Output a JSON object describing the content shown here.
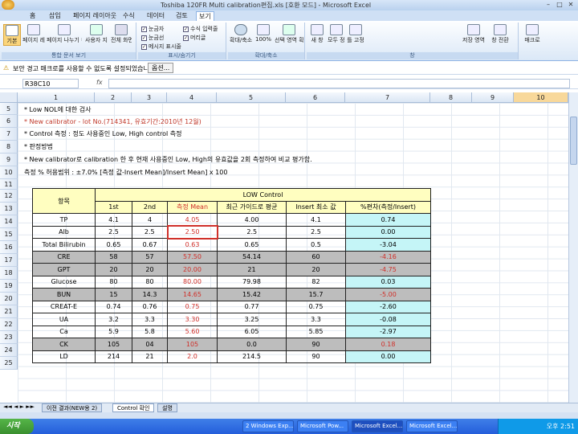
{
  "window": {
    "title": "Toshiba 120FR Multi calibration편집.xls [호환 모드] - Microsoft Excel"
  },
  "ribbon_tabs": [
    "홈",
    "삽입",
    "페이지 레이아웃",
    "수식",
    "데이터",
    "검토",
    "보기"
  ],
  "ribbon": {
    "group_labels": [
      "통합 문서 보기",
      "표시/숨기기",
      "확대/축소",
      "창"
    ],
    "buttons": [
      "기본",
      "페이지 레이아웃",
      "페이지 나누기 미리 보기",
      "사용자 지정 보기",
      "전체 화면",
      "확대/축소",
      "100%",
      "선택 영역 확대/축소",
      "새 창",
      "모두 정렬",
      "틀 고정",
      "저장 영역",
      "창 전환",
      "매크로"
    ],
    "checkboxes": [
      "눈금자",
      "수식 입력줄",
      "눈금선",
      "머리글",
      "메시지 표시줄"
    ]
  },
  "security_bar": {
    "text": "보안 경고 매크로를 사용할 수 없도록 설정되었습니다.",
    "options_label": "옵션..."
  },
  "formula_bar": {
    "name_box": "R38C10",
    "fx": "fx"
  },
  "columns": [
    "1",
    "2",
    "3",
    "4",
    "5",
    "6",
    "7",
    "8",
    "9",
    "10"
  ],
  "rows": [
    "5",
    "6",
    "7",
    "8",
    "9",
    "10",
    "11",
    "12",
    "13",
    "14",
    "15",
    "16",
    "17",
    "18",
    "19",
    "20",
    "21",
    "22",
    "23",
    "24",
    "25"
  ],
  "notes": [
    {
      "text": "* Low NOL에 대한 검사",
      "red": false
    },
    {
      "text": "* New calibrator - lot No.(714341, 유효기간:2010년 12월)",
      "red": true
    },
    {
      "text": "* Control 측정 : 정도 사용중인 Low, High control 측정",
      "red": false
    },
    {
      "text": "* 판정방법",
      "red": false
    },
    {
      "text": "* New calibrator로 calibration 한 후 현재 사용중인 Low, High의 유효값을 2회 측정하여 비교 평가함.",
      "red": false
    },
    {
      "text": "측정 % 허용범위 : ±7.0% [측정 값-Insert Mean]/Insert Mean] x 100",
      "red": false
    }
  ],
  "table": {
    "item_label": "항목",
    "group_label": "LOW Control",
    "headers": [
      "1st",
      "2nd",
      "측정 Mean",
      "최근 가이드로 평균",
      "Insert 최소 값",
      "%편차(측정/Insert)"
    ],
    "rows": [
      {
        "item": "TP",
        "v1": "4.1",
        "v2": "4",
        "mean": "4.05",
        "recent": "4.00",
        "insert": "4.1",
        "pct": "0.74",
        "gray": false,
        "pct_red": false
      },
      {
        "item": "Alb",
        "v1": "2.5",
        "v2": "2.5",
        "mean": "2.50",
        "recent": "2.5",
        "insert": "2.5",
        "pct": "0.00",
        "gray": false,
        "pct_red": false
      },
      {
        "item": "Total Bilirubin",
        "v1": "0.65",
        "v2": "0.67",
        "mean": "0.63",
        "recent": "0.65",
        "insert": "0.5",
        "pct": "-3.04",
        "gray": false,
        "pct_red": false
      },
      {
        "item": "CRE",
        "v1": "58",
        "v2": "57",
        "mean": "57.50",
        "recent": "54.14",
        "insert": "60",
        "pct": "-4.16",
        "gray": true,
        "pct_red": true
      },
      {
        "item": "GPT",
        "v1": "20",
        "v2": "20",
        "mean": "20.00",
        "recent": "21",
        "insert": "20",
        "pct": "-4.75",
        "gray": true,
        "pct_red": true
      },
      {
        "item": "Glucose",
        "v1": "80",
        "v2": "80",
        "mean": "80.00",
        "recent": "79.98",
        "insert": "82",
        "pct": "0.03",
        "gray": false,
        "pct_red": false
      },
      {
        "item": "BUN",
        "v1": "15",
        "v2": "14.3",
        "mean": "14.65",
        "recent": "15.42",
        "insert": "15.7",
        "pct": "-5.00",
        "gray": true,
        "pct_red": true
      },
      {
        "item": "CREAT-E",
        "v1": "0.74",
        "v2": "0.76",
        "mean": "0.75",
        "recent": "0.77",
        "insert": "0.75",
        "pct": "-2.60",
        "gray": false,
        "pct_red": false
      },
      {
        "item": "UA",
        "v1": "3.2",
        "v2": "3.3",
        "mean": "3.30",
        "recent": "3.25",
        "insert": "3.3",
        "pct": "-0.08",
        "gray": false,
        "pct_red": false
      },
      {
        "item": "Ca",
        "v1": "5.9",
        "v2": "5.8",
        "mean": "5.60",
        "recent": "6.05",
        "insert": "5.85",
        "pct": "-2.97",
        "gray": false,
        "pct_red": false
      },
      {
        "item": "CK",
        "v1": "105",
        "v2": "04",
        "mean": "105",
        "recent": "0.0",
        "insert": "90",
        "pct": "0.18",
        "gray": true,
        "pct_red": true
      },
      {
        "item": "LD",
        "v1": "214",
        "v2": "21",
        "mean": "2.0",
        "recent": "214.5",
        "insert": "90",
        "pct": "0.00",
        "gray": false,
        "pct_red": false
      }
    ]
  },
  "sheet_tabs": [
    "이전 결과(NEW용 2)",
    "Control 확인",
    "설명"
  ],
  "taskbar": {
    "start": "시작",
    "items": [
      "2 Windows Exp...",
      "Microsoft Pow...",
      "Microsoft Excel...",
      "Microsoft Excel..."
    ],
    "time": "오후 2:51"
  }
}
